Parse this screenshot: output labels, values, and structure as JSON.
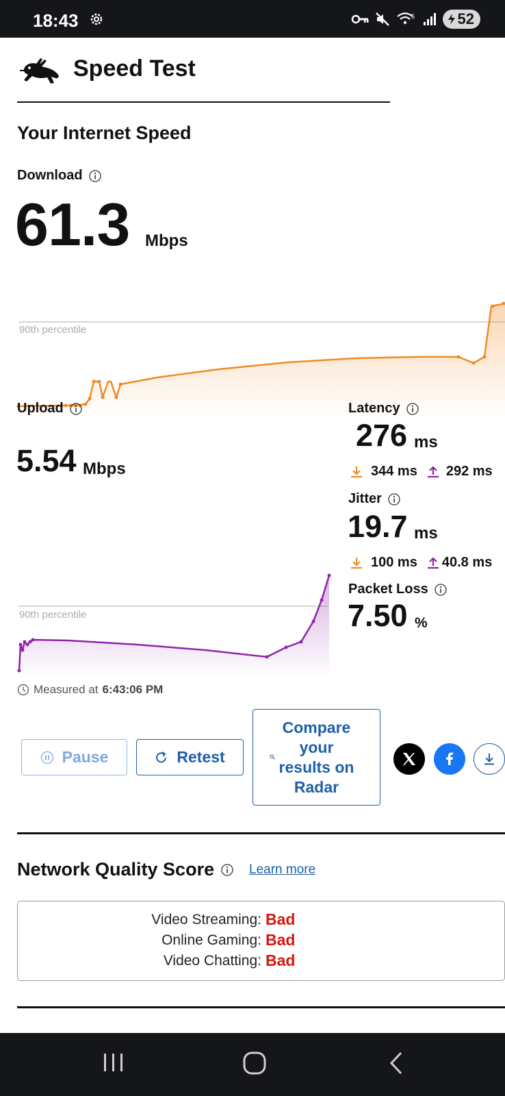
{
  "status_bar": {
    "time": "18:43",
    "battery": "52",
    "icons": [
      "settings-icon",
      "vpn-key-icon",
      "mute-icon",
      "wifi-icon",
      "signal-icon",
      "battery-icon"
    ]
  },
  "header": {
    "title": "Speed Test",
    "logo": "rabbit-icon"
  },
  "section_title": "Your Internet Speed",
  "download": {
    "label": "Download",
    "value": "61.3",
    "unit": "Mbps",
    "percentile_label": "90th percentile",
    "color": "#f08a24"
  },
  "upload": {
    "label": "Upload",
    "value": "5.54",
    "unit": "Mbps",
    "percentile_label": "90th percentile",
    "color": "#8e24aa"
  },
  "latency": {
    "label": "Latency",
    "value": "276",
    "unit": "ms",
    "down": "344 ms",
    "up": "292 ms"
  },
  "jitter": {
    "label": "Jitter",
    "value": "19.7",
    "unit": "ms",
    "down": "100 ms",
    "up": "40.8 ms"
  },
  "packet_loss": {
    "label": "Packet Loss",
    "value": "7.50",
    "unit": "%"
  },
  "measured": {
    "prefix": "Measured at",
    "time": "6:43:06 PM"
  },
  "buttons": {
    "pause": "Pause",
    "retest": "Retest",
    "compare": "Compare your results on Radar"
  },
  "share": [
    "x-icon",
    "facebook-icon",
    "download-icon"
  ],
  "network_quality": {
    "title": "Network Quality Score",
    "learn_more": "Learn more",
    "rows": [
      {
        "label": "Video Streaming:",
        "value": "Bad"
      },
      {
        "label": "Online Gaming:",
        "value": "Bad"
      },
      {
        "label": "Video Chatting:",
        "value": "Bad"
      }
    ]
  },
  "nav_bar": [
    "recent-apps-icon",
    "home-icon",
    "back-icon"
  ]
}
